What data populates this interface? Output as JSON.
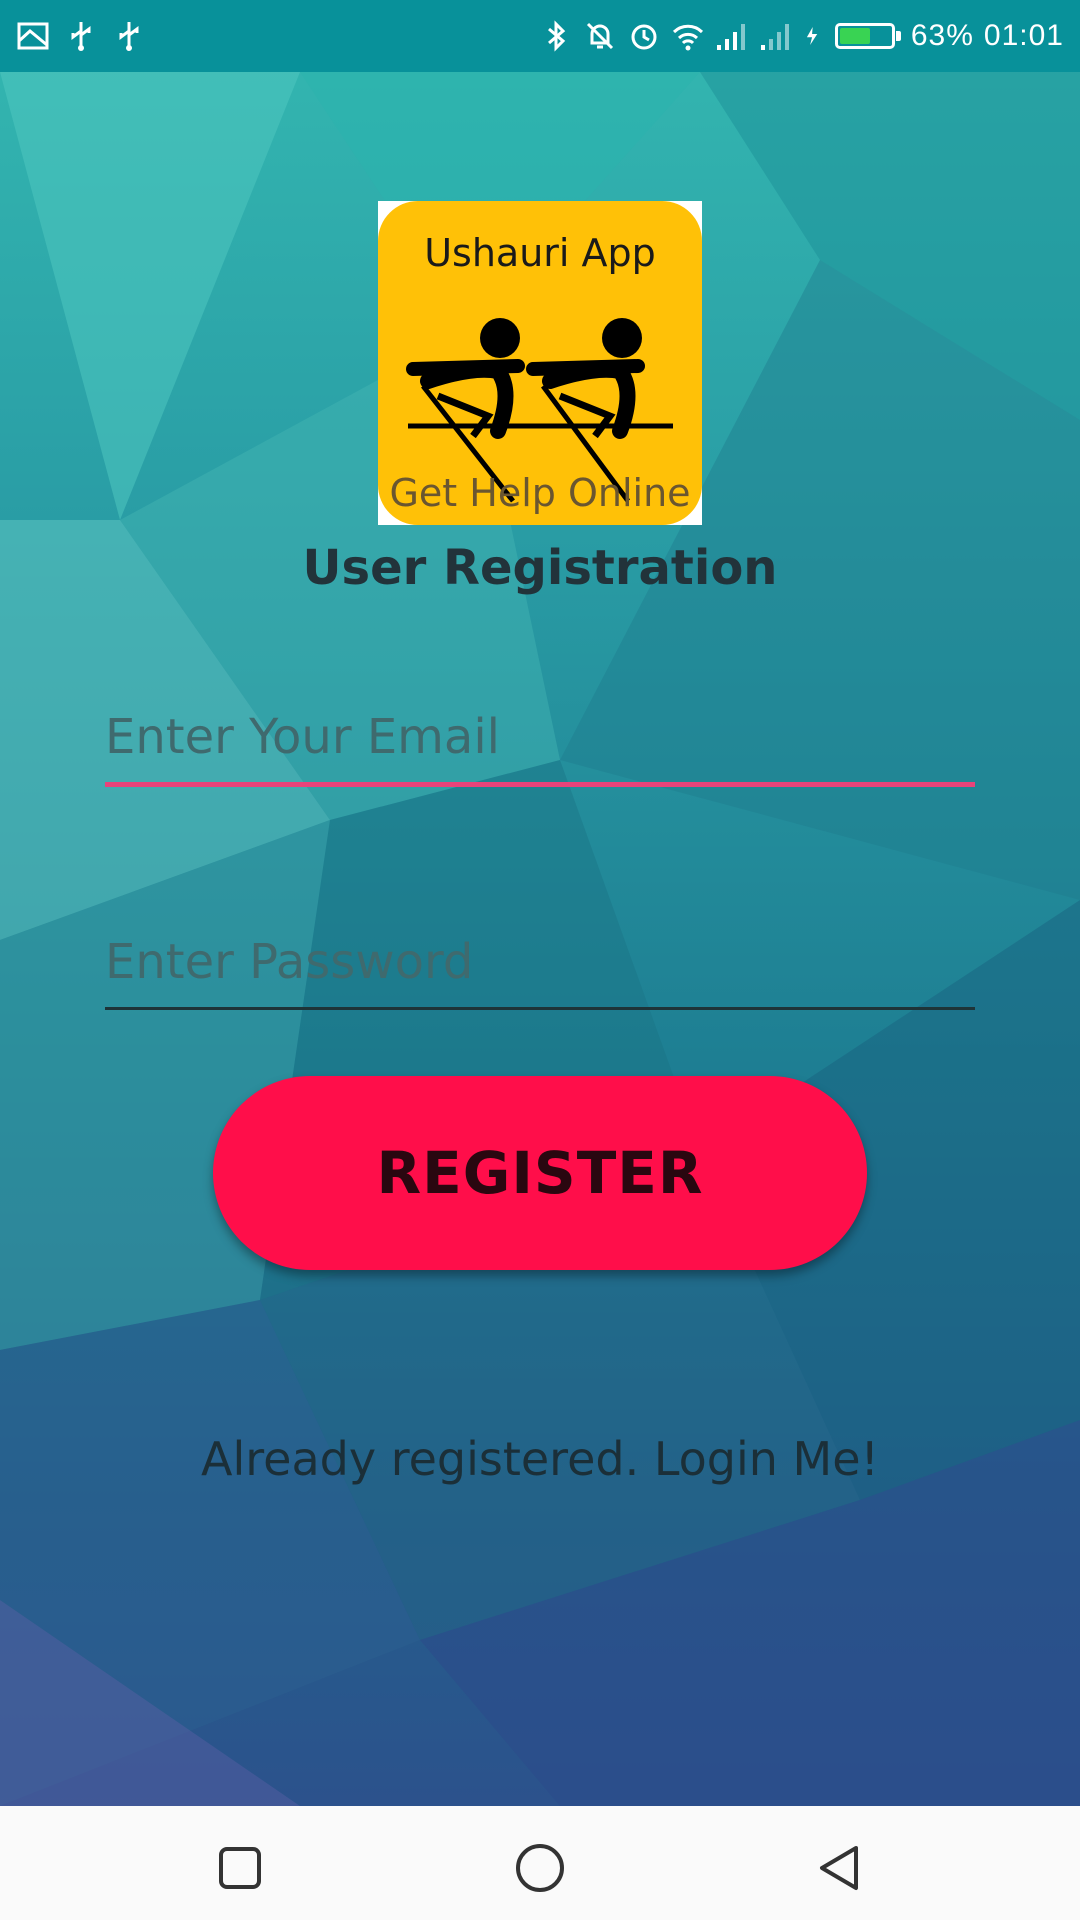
{
  "status_bar": {
    "battery_percent": "63%",
    "battery_level": 0.63,
    "time": "01:01",
    "left_icons": [
      "screenshot-icon",
      "usb-icon",
      "usb-icon"
    ],
    "right_icons": [
      "bluetooth-icon",
      "mute-icon",
      "alarm-icon",
      "wifi-icon",
      "signal-icon",
      "signal-icon",
      "charging-icon"
    ]
  },
  "logo": {
    "title": "Ushauri App",
    "subtitle": "Get Help Online"
  },
  "page": {
    "title": "User Registration"
  },
  "form": {
    "email_placeholder": "Enter Your Email",
    "email_value": "",
    "password_placeholder": "Enter Password",
    "password_value": "",
    "register_label": "REGISTER",
    "login_link": "Already registered. Login Me!"
  },
  "nav_bar": {
    "buttons": [
      "recents-icon",
      "home-icon",
      "back-icon"
    ]
  },
  "colors": {
    "status_bar": "#08919a",
    "button": "#ff0e4a",
    "email_underline": "#e8437a",
    "logo_bg": "#ffc107"
  }
}
